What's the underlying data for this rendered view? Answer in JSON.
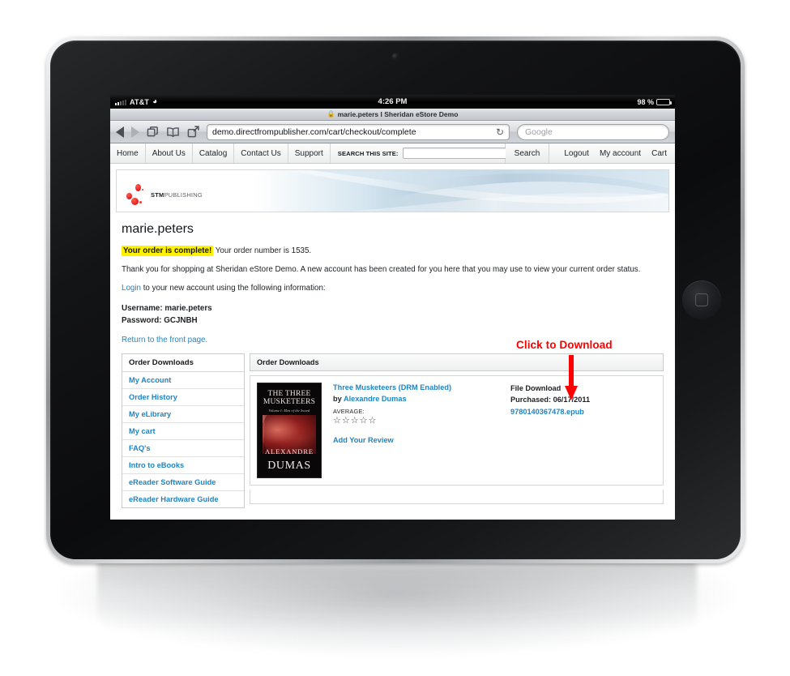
{
  "device": {
    "name": "ipad-landscape",
    "home_button": "home-button"
  },
  "ios_status_bar": {
    "carrier": "AT&T",
    "wifi_icon": "wifi-icon",
    "signal_icon": "signal-bars-icon",
    "time": "4:26 PM",
    "battery_percent": "98 %",
    "battery_icon": "battery-icon"
  },
  "safari": {
    "page_title": "marie.peters I Sheridan eStore Demo",
    "lock_icon": "lock-icon",
    "back_icon": "back-arrow-icon",
    "forward_icon": "forward-arrow-icon",
    "pages_icon": "pages-icon",
    "bookmarks_icon": "bookmarks-book-icon",
    "share_icon": "share-icon",
    "url": "demo.directfrompublisher.com/cart/checkout/complete",
    "reload_icon": "reload-icon",
    "search_placeholder": "Google"
  },
  "site_nav": {
    "tabs": [
      {
        "label": "Home"
      },
      {
        "label": "About Us"
      },
      {
        "label": "Catalog"
      },
      {
        "label": "Contact Us"
      },
      {
        "label": "Support"
      }
    ],
    "search_label": "SEARCH THIS SITE:",
    "search_value": "",
    "search_button": "Search",
    "account_links": [
      {
        "label": "Logout"
      },
      {
        "label": "My account"
      },
      {
        "label": "Cart"
      }
    ]
  },
  "banner": {
    "logo_bold": "STM",
    "logo_light": "PUBLISHING",
    "logo_icon": "stm-publishing-logo-icon"
  },
  "content": {
    "heading": "marie.peters",
    "order_badge": "Your order is complete!",
    "order_number_text": "Your order number is 1535.",
    "thank_you": "Thank you for shopping at Sheridan eStore Demo. A new account has been created for you here that you may use to view your current order status.",
    "login_link": "Login",
    "login_rest": " to your new account using the following information:",
    "username_line": "Username: marie.peters",
    "password_line": "Password: GCJNBH",
    "return_link": "Return to the front page."
  },
  "sidebar": {
    "header": "Order Downloads",
    "items": [
      {
        "label": "My Account"
      },
      {
        "label": "Order History"
      },
      {
        "label": "My eLibrary"
      },
      {
        "label": "My cart"
      },
      {
        "label": "FAQ's"
      },
      {
        "label": "Intro to eBooks"
      },
      {
        "label": "eReader Software Guide"
      },
      {
        "label": "eReader Hardware Guide"
      }
    ]
  },
  "download_panel": {
    "title": "Order Downloads",
    "item": {
      "cover": {
        "title": "THE THREE MUSKETEERS",
        "subtitle": "Volume I: Men of the Sword",
        "author_first": "ALEXANDRE",
        "author_last": "DUMAS"
      },
      "title_link": "Three Musketeers (DRM Enabled)",
      "by_prefix": "by ",
      "author_link": "Alexandre Dumas",
      "average_label": "AVERAGE:",
      "stars": "☆☆☆☆☆",
      "rating_value": 0,
      "rating_max": 5,
      "add_review_link": "Add Your Review",
      "file_download_label": "File Download",
      "purchased_line": "Purchased: 06/17/2011",
      "file_link": "9780140367478.epub"
    }
  },
  "annotation": {
    "label": "Click to Download",
    "color": "#ff0000",
    "arrow_icon": "down-arrow-annotation-icon"
  }
}
